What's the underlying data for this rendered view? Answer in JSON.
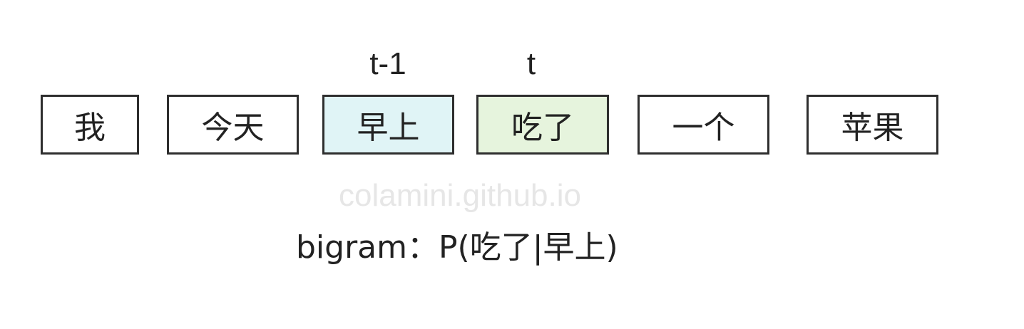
{
  "tokens": [
    {
      "text": "我",
      "fill": "#ffffff"
    },
    {
      "text": "今天",
      "fill": "#ffffff"
    },
    {
      "text": "早上",
      "fill": "#e0f4f6"
    },
    {
      "text": "吃了",
      "fill": "#e6f4dd"
    },
    {
      "text": "一个",
      "fill": "#ffffff"
    },
    {
      "text": "苹果",
      "fill": "#ffffff"
    }
  ],
  "labels": {
    "prev": "t-1",
    "current": "t"
  },
  "watermark": "colamini.github.io",
  "formula": "bigram：P(吃了|早上)",
  "colors": {
    "border": "#2e2e2e",
    "text": "#222222",
    "watermark": "#e6e6e6",
    "prev_fill": "#e0f4f6",
    "current_fill": "#e6f4dd"
  }
}
